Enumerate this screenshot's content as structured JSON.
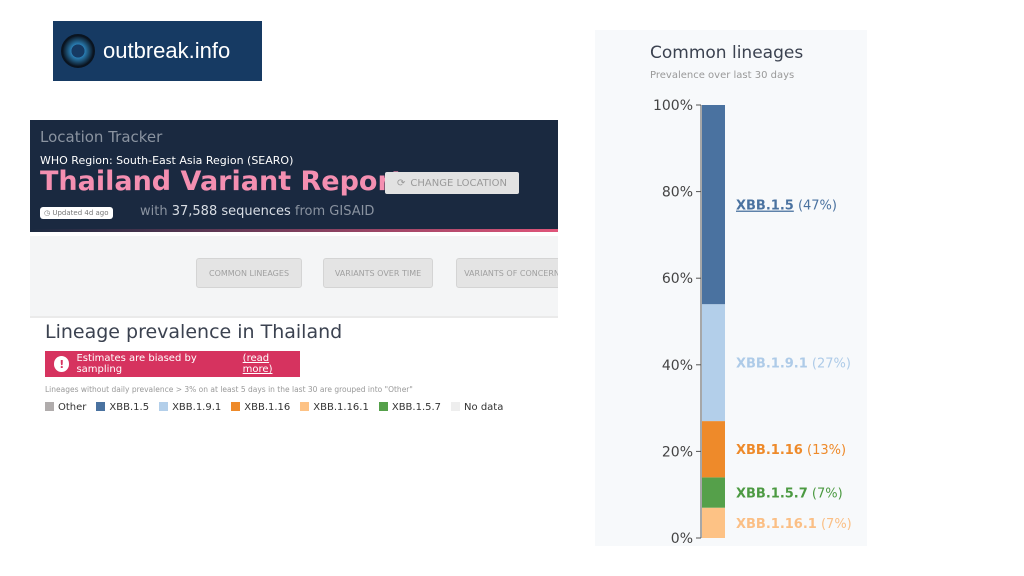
{
  "logo": {
    "text": "outbreak.info",
    "bg": "#163a63"
  },
  "header": {
    "section": "Location Tracker",
    "region": "WHO Region: South-East Asia Region (SEARO)",
    "title": "Thailand Variant Report",
    "change_location": "CHANGE LOCATION",
    "updated": "Updated 4d ago",
    "seq_prefix": "with",
    "seq_count": "37,588 sequences",
    "seq_suffix": "from GISAID"
  },
  "nav": [
    "COMMON LINEAGES",
    "VARIANTS OVER TIME",
    "VARIANTS OF CONCERN"
  ],
  "prevalence": {
    "title": "Lineage prevalence in Thailand",
    "warning": "Estimates are biased by sampling",
    "warning_link": "(read more)",
    "note": "Lineages without daily prevalence > 3% on at least 5 days in the last 30 are grouped into \"Other\"",
    "legend": [
      {
        "label": "Other",
        "color": "#b0acac"
      },
      {
        "label": "XBB.1.5",
        "color": "#4a72a0"
      },
      {
        "label": "XBB.1.9.1",
        "color": "#b3cfea"
      },
      {
        "label": "XBB.1.16",
        "color": "#ee8a2a"
      },
      {
        "label": "XBB.1.16.1",
        "color": "#fdc285"
      },
      {
        "label": "XBB.1.5.7",
        "color": "#55a04a"
      },
      {
        "label": "No data",
        "color": "#eeeeee"
      }
    ]
  },
  "chart_data": {
    "type": "bar",
    "title": "Common lineages",
    "subtitle": "Prevalence over last 30 days",
    "stacked": true,
    "ylim": [
      0,
      100
    ],
    "yticks": [
      "0%",
      "20%",
      "40%",
      "60%",
      "80%",
      "100%"
    ],
    "series": [
      {
        "name": "XBB.1.16.1",
        "value": 7,
        "label": "(7%)",
        "color": "#fdc285",
        "text_color": "#fbbf85"
      },
      {
        "name": "XBB.1.5.7",
        "value": 7,
        "label": "(7%)",
        "color": "#55a04a",
        "text_color": "#4c9a42"
      },
      {
        "name": "XBB.1.16",
        "value": 13,
        "label": "(13%)",
        "color": "#ee8a2a",
        "text_color": "#ee8a2a"
      },
      {
        "name": "XBB.1.9.1",
        "value": 27,
        "label": "(27%)",
        "color": "#b3cfea",
        "text_color": "#aecbe8"
      },
      {
        "name": "XBB.1.5",
        "value": 47,
        "label": "(47%)",
        "color": "#4a72a0",
        "text_color": "#4a72a0"
      }
    ]
  }
}
